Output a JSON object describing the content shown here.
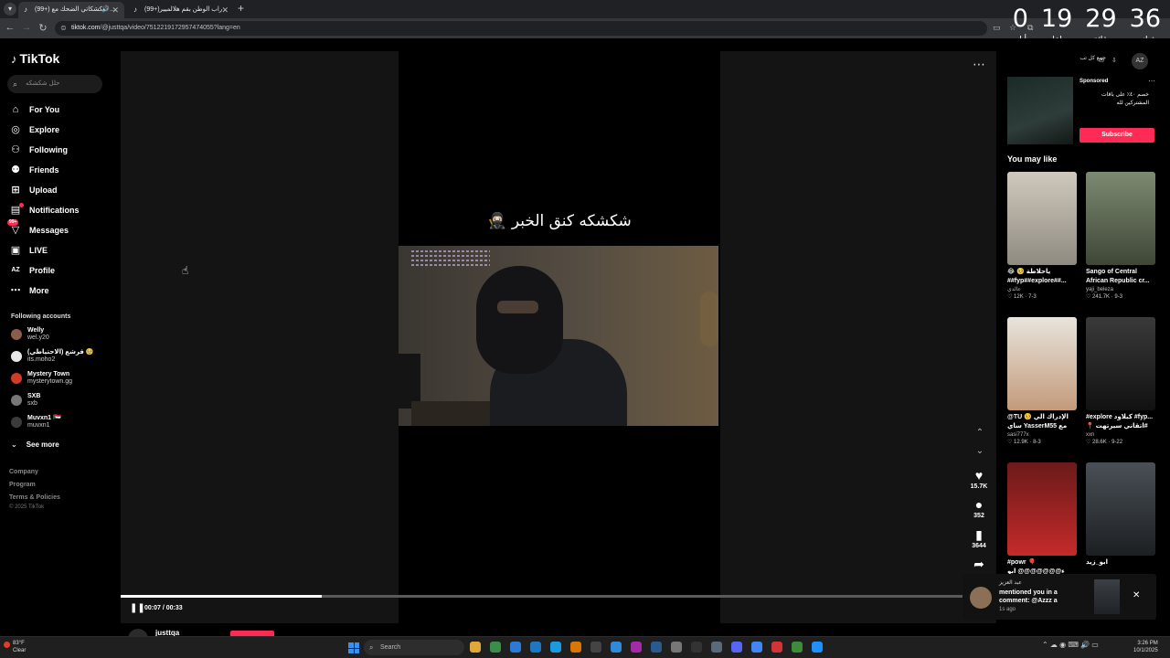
{
  "browser": {
    "tabs": [
      {
        "title": "(99+) شكشكاتي الضحك مع ...",
        "active": true,
        "audio": true
      },
      {
        "title": "(99+)راب الوطن بقم هلالميير",
        "active": false,
        "audio": false
      }
    ],
    "url_host": "tiktok.com",
    "url_path": "/@justtqa/video/7512219172957474055?lang=en"
  },
  "countdown": {
    "days": "0",
    "days_label": "أيام",
    "hours": "19",
    "hours_label": "ساعات",
    "minutes": "29",
    "minutes_label": "دقائق",
    "seconds": "36",
    "seconds_label": "ثواني"
  },
  "sidebar": {
    "logo": "TikTok",
    "search_placeholder": "حلل شكشكه",
    "nav": [
      {
        "label": "For You",
        "icon": "home-icon"
      },
      {
        "label": "Explore",
        "icon": "compass-icon"
      },
      {
        "label": "Following",
        "icon": "following-icon"
      },
      {
        "label": "Friends",
        "icon": "friends-icon"
      },
      {
        "label": "Upload",
        "icon": "upload-icon"
      },
      {
        "label": "Notifications",
        "icon": "notification-icon"
      },
      {
        "label": "Messages",
        "icon": "messages-icon",
        "badge": "99+"
      },
      {
        "label": "LIVE",
        "icon": "live-icon"
      },
      {
        "label": "Profile",
        "icon": "profile-icon"
      },
      {
        "label": "More",
        "icon": "more-icon"
      }
    ],
    "following_title": "Following accounts",
    "accounts": [
      {
        "name": "Welly",
        "user": "wel.y20",
        "color": "#8b5e4b"
      },
      {
        "name": "قرشع (الاحتياطي) 🥹",
        "user": "its.moho2",
        "color": "#e8e8e8"
      },
      {
        "name": "Mystery Town",
        "user": "mysterytown.gg",
        "color": "#d23a2a"
      },
      {
        "name": "SXB",
        "user": "sxb",
        "color": "#777777"
      },
      {
        "name": "Muvxn1 🇸🇩",
        "user": "muvxn1",
        "color": "#3c3c3c"
      }
    ],
    "see_more": "See more",
    "footer": [
      "Company",
      "Program",
      "Terms & Policies"
    ],
    "copyright": "© 2025 TikTok"
  },
  "video": {
    "caption": "شكشكه كنق الخبر 🥷🏻",
    "current_time": "00:07",
    "duration": "00:33",
    "time_display": "00:07 / 00:33",
    "progress_fraction": 0.23,
    "author": "justtqa"
  },
  "actions": {
    "likes": "15.7K",
    "comments": "352",
    "saves": "3644"
  },
  "right": {
    "ad_top_text": "جمع كل تب",
    "az_label": "AZ",
    "sponsored_label": "Sponsored",
    "ad_text": "خصم ٤٠٪ على باقات المشتركين لله",
    "subscribe_label": "Subscribe",
    "you_may_like": "You may like",
    "cards": [
      {
        "title": "😂 🥺 ياحلاطة ##fyp##explore##...",
        "user": "عالدي",
        "likes": "12K",
        "date": "7-3",
        "thumb": "#b8b2a6"
      },
      {
        "title": "Sango of Central African Republic cr...",
        "user": "yaji_beleza",
        "likes": "241.7K",
        "date": "9-3",
        "thumb": "#6f7a63"
      },
      {
        "title": "@TU 🥺 الإدراك الي ساي YasserM55 مع ريلس ...",
        "user": "sasi777x",
        "likes": "12.9K",
        "date": "8-3",
        "thumb": "#c8a78a"
      },
      {
        "title": "#explore كبلاود #fyp... 📍 اتقاني سيرتهت#",
        "user": "xxn",
        "likes": "28.6K",
        "date": "9-22",
        "thumb": "#2e2e2e"
      },
      {
        "title": "#powr 🎈ء@@@@@@@ ابو شابو",
        "user": "",
        "likes": "",
        "date": "",
        "thumb": "#9a2222"
      },
      {
        "title": "ابو_زيد",
        "user": "",
        "likes": "",
        "date": "",
        "thumb": "#3b3f43"
      }
    ]
  },
  "toast": {
    "name": "عبد العزيز",
    "message": "mentioned you in a comment: @Azzz a",
    "ago": "1s ago"
  },
  "taskbar": {
    "temp": "83°F",
    "weather": "Clear",
    "search": "Search",
    "time": "3:26 PM",
    "date": "10/1/2025"
  }
}
